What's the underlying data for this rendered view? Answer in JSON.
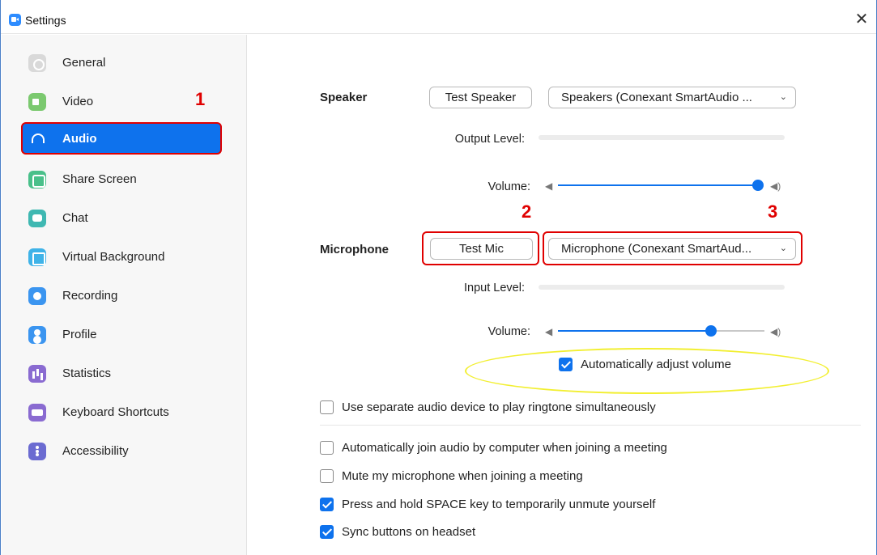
{
  "window": {
    "title": "Settings",
    "close_glyph": "✕"
  },
  "sidebar": {
    "items": [
      {
        "label": "General",
        "icon": "gear-icon"
      },
      {
        "label": "Video",
        "icon": "video-camera-icon"
      },
      {
        "label": "Audio",
        "icon": "headphones-icon",
        "active": true
      },
      {
        "label": "Share Screen",
        "icon": "share-screen-icon"
      },
      {
        "label": "Chat",
        "icon": "chat-bubble-icon"
      },
      {
        "label": "Virtual Background",
        "icon": "virtual-background-icon"
      },
      {
        "label": "Recording",
        "icon": "record-icon"
      },
      {
        "label": "Profile",
        "icon": "profile-icon"
      },
      {
        "label": "Statistics",
        "icon": "statistics-icon"
      },
      {
        "label": "Keyboard Shortcuts",
        "icon": "keyboard-icon"
      },
      {
        "label": "Accessibility",
        "icon": "accessibility-icon"
      }
    ]
  },
  "annotations": {
    "one": "1",
    "two": "2",
    "three": "3"
  },
  "speaker": {
    "label": "Speaker",
    "test_button": "Test Speaker",
    "device": "Speakers (Conexant SmartAudio ...",
    "output_level_label": "Output Level:",
    "output_level": 0,
    "volume_label": "Volume:",
    "volume": 1.0
  },
  "microphone": {
    "label": "Microphone",
    "test_button": "Test Mic",
    "device": "Microphone (Conexant SmartAud...",
    "input_level_label": "Input Level:",
    "input_level": 0,
    "volume_label": "Volume:",
    "volume": 0.74,
    "auto_adjust_label": "Automatically adjust volume",
    "auto_adjust_checked": true
  },
  "options": [
    {
      "label": "Use separate audio device to play ringtone simultaneously",
      "checked": false
    },
    {
      "label": "Automatically join audio by computer when joining a meeting",
      "checked": false
    },
    {
      "label": "Mute my microphone when joining a meeting",
      "checked": false
    },
    {
      "label": "Press and hold SPACE key to temporarily unmute yourself",
      "checked": true
    },
    {
      "label": "Sync buttons on headset",
      "checked": true
    }
  ],
  "colors": {
    "accent": "#0e72ed",
    "annotation_red": "#e00000",
    "highlight_yellow": "#f2ef30"
  }
}
